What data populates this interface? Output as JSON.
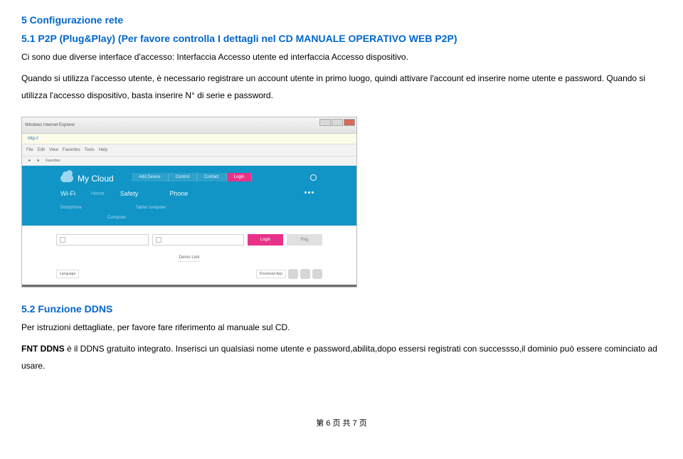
{
  "doc": {
    "h1": "5 Configurazione rete",
    "h2": "5.1 P2P (Plug&Play) (Per favore controlla I dettagli nel CD MANUALE OPERATIVO WEB P2P)",
    "p1": "Ci sono due diverse interface d'accesso: Interfaccia Accesso utente ed interfaccia Accesso dispositivo.",
    "p2": "Quando si utilizza l'accesso utente, è necessario registrare un account utente in primo luogo, quindi attivare l'account ed inserire nome utente e password. Quando si utilizza l'accesso dispositivo, basta inserire N° di serie e password.",
    "h3": "5.2 Funzione DDNS",
    "p3": "Per istruzioni dettagliate, per favore fare riferimento al manuale sul CD.",
    "p4_prefix": "FNT DDNS",
    "p4_rest": " è il DDNS gratuito integrato. Inserisci un qualsiasi nome utente e password,abilita,dopo essersi registrati con successso,il dominio può essere cominciato ad usare.",
    "footer": "第 6 页 共 7 页"
  },
  "shot": {
    "title_bar": "Windows Internet Explorer",
    "url": "http://",
    "toolbar_items": [
      "File",
      "Edit",
      "View",
      "Favorites",
      "Tools",
      "Help"
    ],
    "fav_items": [
      "★",
      "★",
      "Favorites"
    ],
    "brand": "My Cloud",
    "top_tabs": [
      "Add Device",
      "Control",
      "Contact"
    ],
    "active_tab": "Login",
    "cats": {
      "wifi": "Wi-Fi",
      "home": "Home",
      "safety": "Safety",
      "phone_dim": "",
      "phone": "Phone"
    },
    "sub": [
      "Doorphone",
      "Tablet computer"
    ],
    "sub2": "Computer",
    "login": {
      "user_ph": "",
      "pass_ph": "",
      "btn_login": "Login",
      "btn_reg": "Reg"
    },
    "demo": "Demo Link",
    "lang": "Language",
    "app": "Download App"
  }
}
